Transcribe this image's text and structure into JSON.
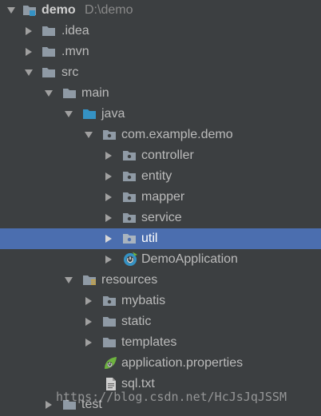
{
  "tree": {
    "root": {
      "label": "demo",
      "path_hint": "D:\\demo"
    },
    "items": {
      "idea": "idea",
      "mvn": "mvn",
      "src": "src",
      "main": "main",
      "java": "java",
      "package": "com.example.demo",
      "controller": "controller",
      "entity": "entity",
      "mapper": "mapper",
      "service": "service",
      "util": "util",
      "demo_application": "DemoApplication",
      "resources": "resources",
      "mybatis": "mybatis",
      "static": "static",
      "templates": "templates",
      "application_properties": "application.properties",
      "sql_txt": "sql.txt",
      "test": "test"
    }
  },
  "watermark": "https://blog.csdn.net/HcJsJqJSSM",
  "colors": {
    "background": "#3c3f41",
    "selection": "#4b6eaf",
    "folder": "#8f9aa5",
    "source_folder": "#3592c4",
    "spring_green": "#6db33f"
  },
  "icons": {
    "arrow_expanded": "triangle-down-icon",
    "arrow_collapsed": "triangle-right-icon",
    "folder": "folder-icon",
    "package": "package-icon",
    "spring_boot": "spring-boot-icon",
    "text_file": "text-file-icon"
  }
}
